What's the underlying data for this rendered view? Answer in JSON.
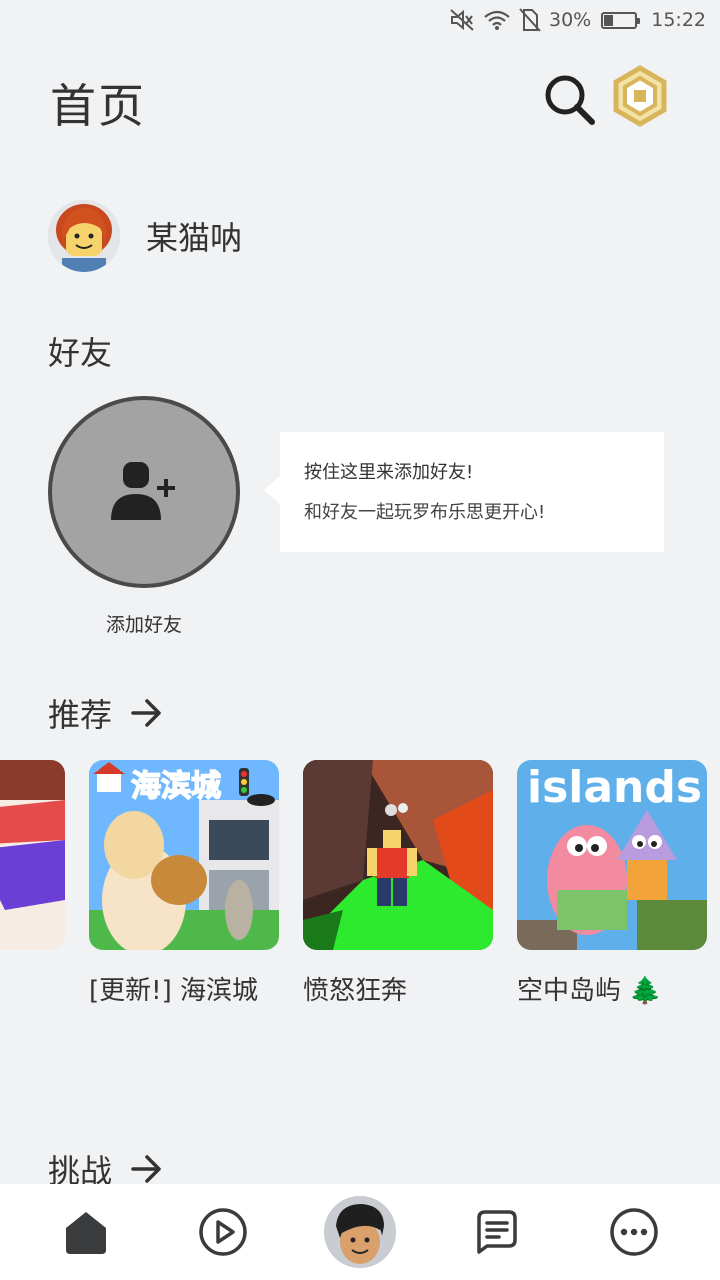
{
  "status_bar": {
    "battery_percent": "30%",
    "battery_level": 0.3,
    "time": "15:22",
    "icons": [
      "mute-icon",
      "wifi-icon",
      "no-sim-icon",
      "battery-icon"
    ]
  },
  "header": {
    "title": "首页",
    "search_icon": "search-icon",
    "robux_icon": "robux-icon"
  },
  "profile": {
    "username": "某猫呐"
  },
  "friends": {
    "section_title": "好友",
    "add_friend_label": "添加好友",
    "tooltip_line1": "按住这里来添加好友!",
    "tooltip_line2": "和好友一起玩罗布乐思更开心!"
  },
  "recommended": {
    "section_title": "推荐",
    "games": [
      {
        "name": ""
      },
      {
        "name": "[更新!] 海滨城",
        "thumb_text": "海滨城"
      },
      {
        "name": "愤怒狂奔"
      },
      {
        "name": "空中岛屿 🌲",
        "thumb_text": "islands"
      }
    ]
  },
  "challenges": {
    "section_title": "挑战"
  },
  "nav": {
    "items": [
      "home-icon",
      "play-icon",
      "avatar",
      "chat-icon",
      "more-icon"
    ]
  },
  "colors": {
    "background": "#f1f2f4",
    "text": "#333333",
    "add_friend_circle": "#a3a3a3",
    "robux_gold": "#d8b55a"
  }
}
